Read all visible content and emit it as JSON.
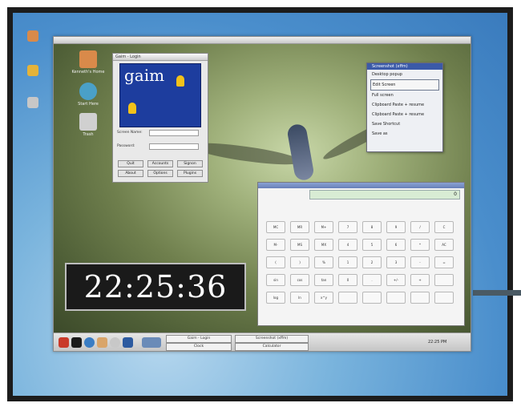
{
  "inner_desktop": {
    "icons": [
      {
        "name": "home-folder-icon",
        "label": "Kenneth's Home",
        "color": "#d98a4a"
      },
      {
        "name": "start-here-icon",
        "label": "Start Here",
        "color": "#4aa0c8"
      },
      {
        "name": "trash-icon",
        "label": "Trash",
        "color": "#d0d0d0"
      }
    ]
  },
  "gaim": {
    "title": "Gaim - Login",
    "logo_text": "gaim",
    "screen_name_label": "Screen Name:",
    "password_label": "Password:",
    "buttons": [
      "Quit",
      "Accounts",
      "Signon",
      "About",
      "Options",
      "Plugins"
    ]
  },
  "menu": {
    "title": "Screenshot (xffm)",
    "items": [
      "Desktop popup",
      "Edit Screen",
      "Full screen",
      "Clipboard Paste + resume",
      "Clipboard Paste + resume",
      "Save Shortcut",
      "Save as"
    ],
    "selected_index": 1
  },
  "calculator": {
    "display": "0",
    "keys": [
      [
        "MC",
        "MR",
        "M+",
        "7",
        "8",
        "9",
        "/",
        "C"
      ],
      [
        "M-",
        "MS",
        "MX",
        "4",
        "5",
        "6",
        "*",
        "AC"
      ],
      [
        "(",
        ")",
        "%",
        "1",
        "2",
        "3",
        "-",
        "="
      ],
      [
        "sin",
        "cos",
        "tan",
        "0",
        ".",
        "+/-",
        "+",
        ""
      ],
      [
        "log",
        "ln",
        "x^y",
        "",
        "",
        "",
        "",
        ""
      ]
    ]
  },
  "clock": {
    "time": "22:25:36"
  },
  "taskbar": {
    "tasks": [
      "Gaim - Login",
      "Screenshot (xffm)",
      "Calculator",
      "Clock"
    ],
    "clock": "22:25 PM"
  },
  "colors": {
    "desktop_blue": "#4a8ecc",
    "gaim_blue": "#1d3d9e",
    "menu_title": "#3b5aa8",
    "calc_display": "#d8ecd4"
  }
}
